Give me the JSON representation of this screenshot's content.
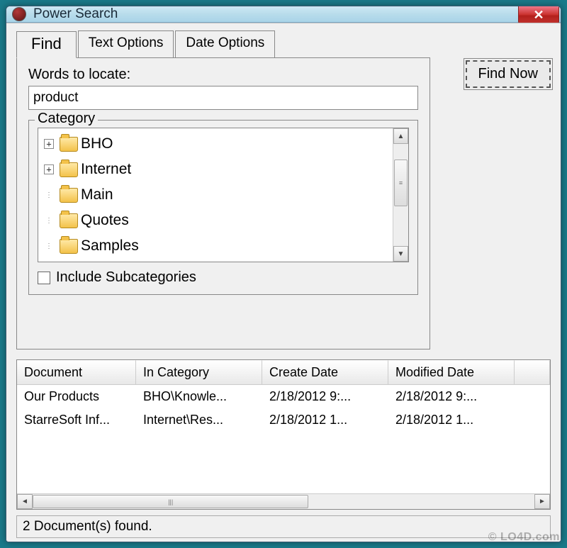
{
  "window": {
    "title": "Power Search"
  },
  "tabs": {
    "find": "Find",
    "text_options": "Text Options",
    "date_options": "Date Options",
    "active": "find"
  },
  "find": {
    "words_label": "Words to locate:",
    "words_value": "product",
    "category_label": "Category",
    "tree": [
      {
        "expandable": true,
        "label": "BHO"
      },
      {
        "expandable": true,
        "label": "Internet"
      },
      {
        "expandable": false,
        "label": "Main"
      },
      {
        "expandable": false,
        "label": "Quotes"
      },
      {
        "expandable": false,
        "label": "Samples"
      }
    ],
    "include_sub_label": "Include Subcategories",
    "include_sub_checked": false
  },
  "buttons": {
    "find_now": "Find Now"
  },
  "results": {
    "columns": {
      "document": "Document",
      "in_category": "In Category",
      "create_date": "Create Date",
      "modified_date": "Modified Date"
    },
    "rows": [
      {
        "document": "Our Products",
        "in_category": "BHO\\Knowle...",
        "create_date": "2/18/2012 9:...",
        "modified_date": "2/18/2012 9:..."
      },
      {
        "document": "StarreSoft Inf...",
        "in_category": "Internet\\Res...",
        "create_date": "2/18/2012 1...",
        "modified_date": "2/18/2012 1..."
      }
    ]
  },
  "status": {
    "text": "2 Document(s) found."
  },
  "watermark": "© LO4D.com"
}
